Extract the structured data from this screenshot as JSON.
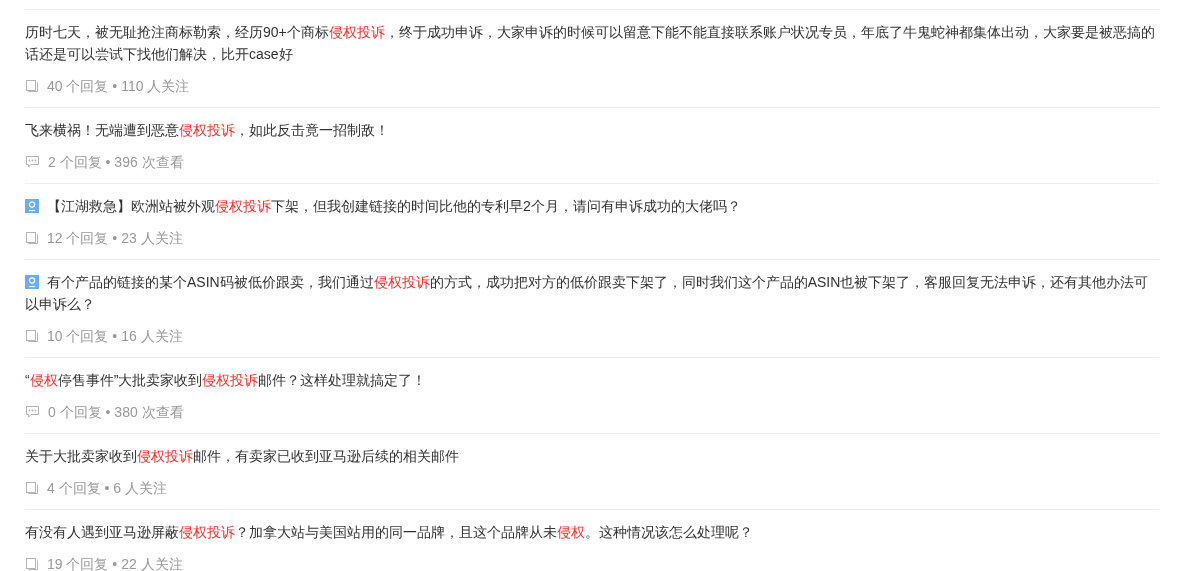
{
  "questions": [
    {
      "badge": false,
      "title": [
        {
          "text": "历时七天，被无耻抢注商标勒索，经历90+个商标",
          "highlight": false
        },
        {
          "text": "侵权投诉",
          "highlight": true
        },
        {
          "text": "，终于成功申诉，大家申诉的时候可以留意下能不能直接联系账户状况专员，年底了牛鬼蛇神都集体出动，大家要是被恶搞的话还是可以尝试下找他们解决，比开case好",
          "highlight": false
        }
      ],
      "kind": "answers",
      "stats": "40 个回复 • 110 人关注"
    },
    {
      "badge": false,
      "title": [
        {
          "text": "飞来横祸！无端遭到恶意",
          "highlight": false
        },
        {
          "text": "侵权投诉",
          "highlight": true
        },
        {
          "text": "，如此反击竟一招制敌！",
          "highlight": false
        }
      ],
      "kind": "comments",
      "stats": "2 个回复 • 396 次查看"
    },
    {
      "badge": true,
      "title": [
        {
          "text": "【江湖救急】欧洲站被外观",
          "highlight": false
        },
        {
          "text": "侵权投诉",
          "highlight": true
        },
        {
          "text": "下架，但我创建链接的时间比他的专利早2个月，请问有申诉成功的大佬吗？",
          "highlight": false
        }
      ],
      "kind": "answers",
      "stats": "12 个回复 • 23 人关注"
    },
    {
      "badge": true,
      "title": [
        {
          "text": "有个产品的链接的某个ASIN码被低价跟卖，我们通过",
          "highlight": false
        },
        {
          "text": "侵权投诉",
          "highlight": true
        },
        {
          "text": "的方式，成功把对方的低价跟卖下架了，同时我们这个产品的ASIN也被下架了，客服回复无法申诉，还有其他办法可以申诉么？",
          "highlight": false
        }
      ],
      "kind": "answers",
      "stats": "10 个回复 • 16 人关注"
    },
    {
      "badge": false,
      "title": [
        {
          "text": "“",
          "highlight": false
        },
        {
          "text": "侵权",
          "highlight": true
        },
        {
          "text": "停售事件”大批卖家收到",
          "highlight": false
        },
        {
          "text": "侵权投诉",
          "highlight": true
        },
        {
          "text": "邮件？这样处理就搞定了！",
          "highlight": false
        }
      ],
      "kind": "comments",
      "stats": "0 个回复 • 380 次查看"
    },
    {
      "badge": false,
      "title": [
        {
          "text": "关于大批卖家收到",
          "highlight": false
        },
        {
          "text": "侵权投诉",
          "highlight": true
        },
        {
          "text": "邮件，有卖家已收到亚马逊后续的相关邮件",
          "highlight": false
        }
      ],
      "kind": "answers",
      "stats": "4 个回复 • 6 人关注"
    },
    {
      "badge": false,
      "title": [
        {
          "text": "有没有人遇到亚马逊屏蔽",
          "highlight": false
        },
        {
          "text": "侵权投诉",
          "highlight": true
        },
        {
          "text": "？加拿大站与美国站用的同一品牌，且这个品牌从未",
          "highlight": false
        },
        {
          "text": "侵权",
          "highlight": true
        },
        {
          "text": "。这种情况该怎么处理呢？",
          "highlight": false
        }
      ],
      "kind": "answers",
      "stats": "19 个回复 • 22 人关注"
    }
  ]
}
